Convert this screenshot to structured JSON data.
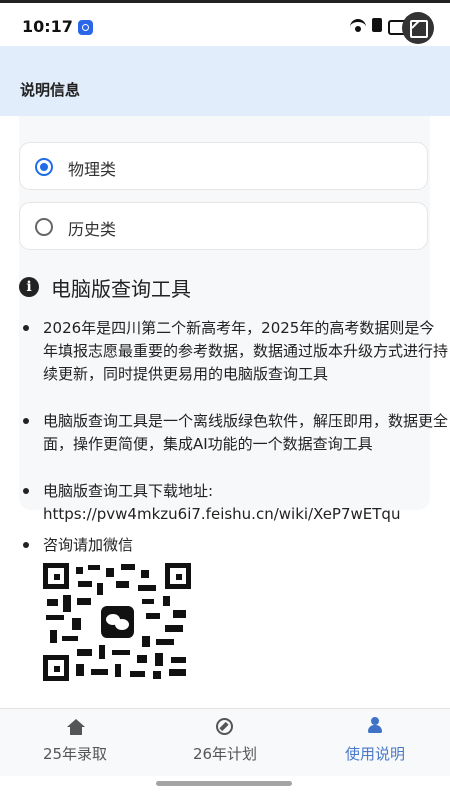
{
  "status_bar": {
    "time": "10:17",
    "icons": [
      "app-mini-icon",
      "wifi-icon",
      "signal-icon",
      "battery-icon",
      "screen-capture-icon"
    ]
  },
  "header": {
    "title": "说明信息"
  },
  "subject_options": {
    "items": [
      {
        "label": "物理类",
        "selected": true
      },
      {
        "label": "历史类",
        "selected": false
      }
    ]
  },
  "tool_section": {
    "title": "电脑版查询工具",
    "bullets": [
      {
        "text": "2026年是四川第二个新高考年，2025年的高考数据则是今年填报志愿最重要的参考数据，数据通过版本升级方式进行持续更新，同时提供更易用的电脑版查询工具"
      },
      {
        "text": "电脑版查询工具是一个离线版绿色软件，解压即用，数据更全面，操作更简便，集成AI功能的一个数据查询工具"
      },
      {
        "text": "电脑版查询工具下载地址:",
        "url": "https://pvw4mkzu6i7.feishu.cn/wiki/XeP7wETqu"
      },
      {
        "text": "咨询请加微信"
      }
    ]
  },
  "bottom_nav": {
    "items": [
      {
        "label": "25年录取",
        "icon": "home-icon",
        "active": false
      },
      {
        "label": "26年计划",
        "icon": "compass-icon",
        "active": false
      },
      {
        "label": "使用说明",
        "icon": "user-icon",
        "active": true
      }
    ]
  },
  "colors": {
    "header_background": "#e2edfb",
    "accent": "#1f6ee8",
    "active_nav": "#4a79c9"
  }
}
